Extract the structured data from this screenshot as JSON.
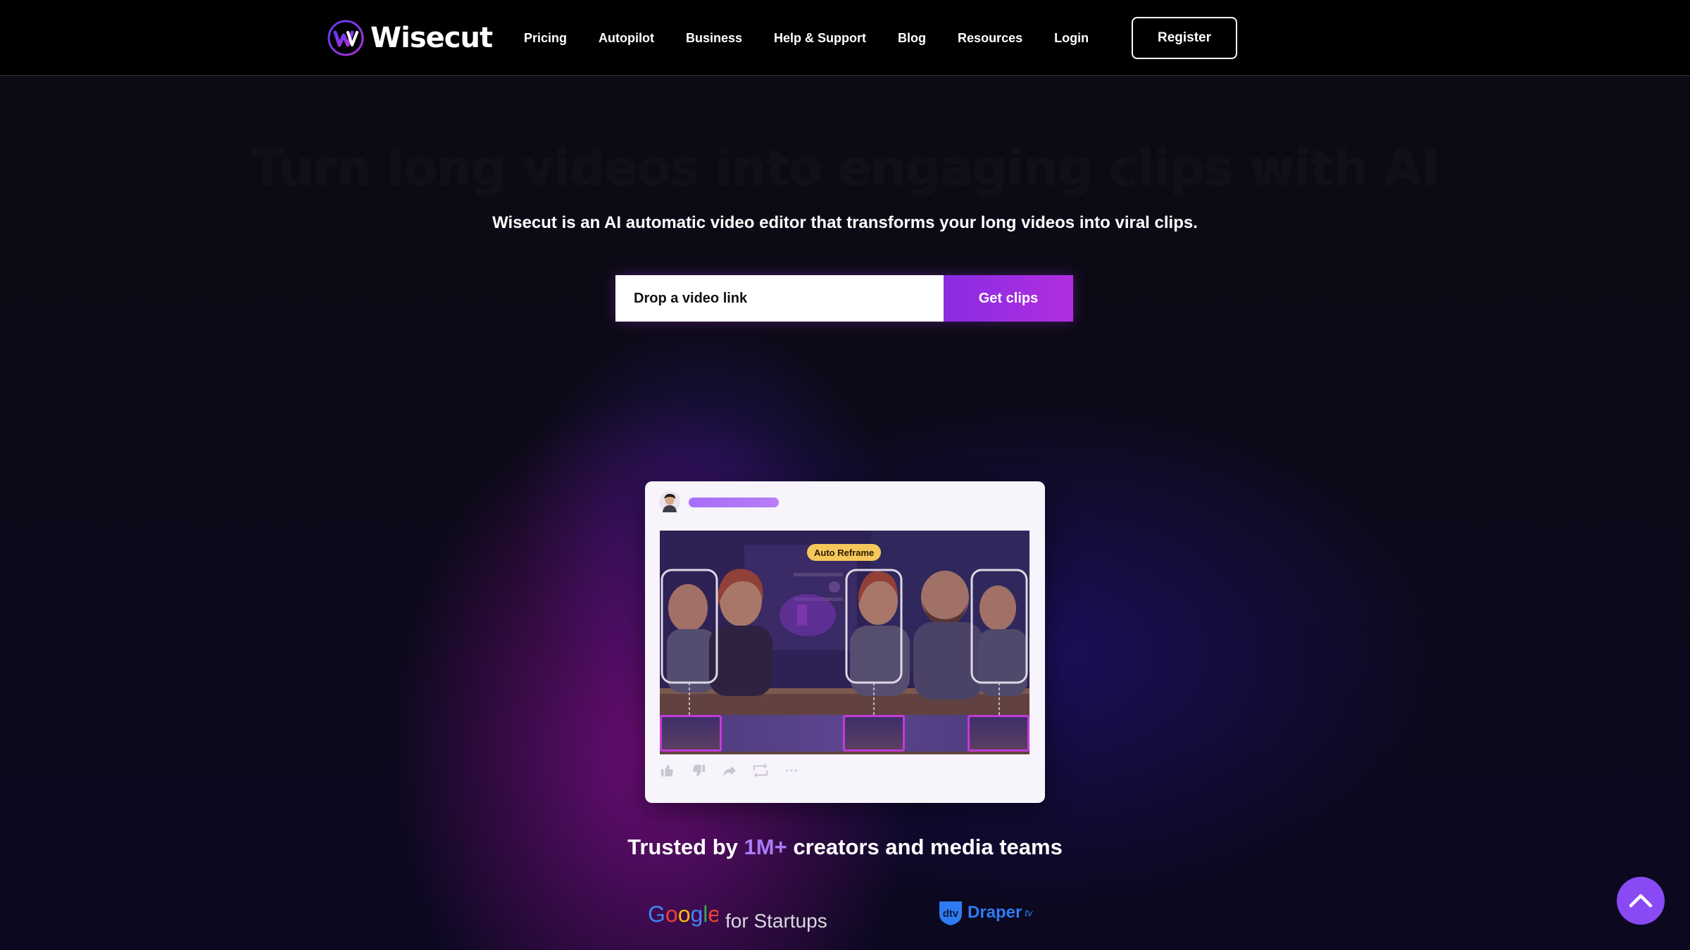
{
  "header": {
    "brand": "Wisecut",
    "nav": [
      "Pricing",
      "Autopilot",
      "Business",
      "Help & Support",
      "Blog",
      "Resources",
      "Login"
    ],
    "register_label": "Register"
  },
  "hero": {
    "title": "Turn long videos into engaging clips with AI",
    "subtitle": "Wisecut is an AI automatic video editor that transforms your long videos into viral clips.",
    "input_placeholder": "Drop a video link",
    "cta_label": "Get clips"
  },
  "preview_card": {
    "badge": "Auto Reframe",
    "actions": [
      "thumbs-up-icon",
      "thumbs-down-icon",
      "share-icon",
      "remix-icon",
      "more-icon"
    ]
  },
  "trusted": {
    "prefix": "Trusted by",
    "highlight": "1M+",
    "suffix": "creators and media teams"
  },
  "partners": {
    "google_word": "Google",
    "google_suffix": "for Startups",
    "draper_badge": "dtv",
    "draper_name": "Draper",
    "draper_tv": "tv"
  },
  "colors": {
    "accent": "#8a2be2",
    "accent_light": "#a77cf8",
    "draper_blue": "#2f7bf2",
    "badge_yellow": "#f6c85a"
  }
}
